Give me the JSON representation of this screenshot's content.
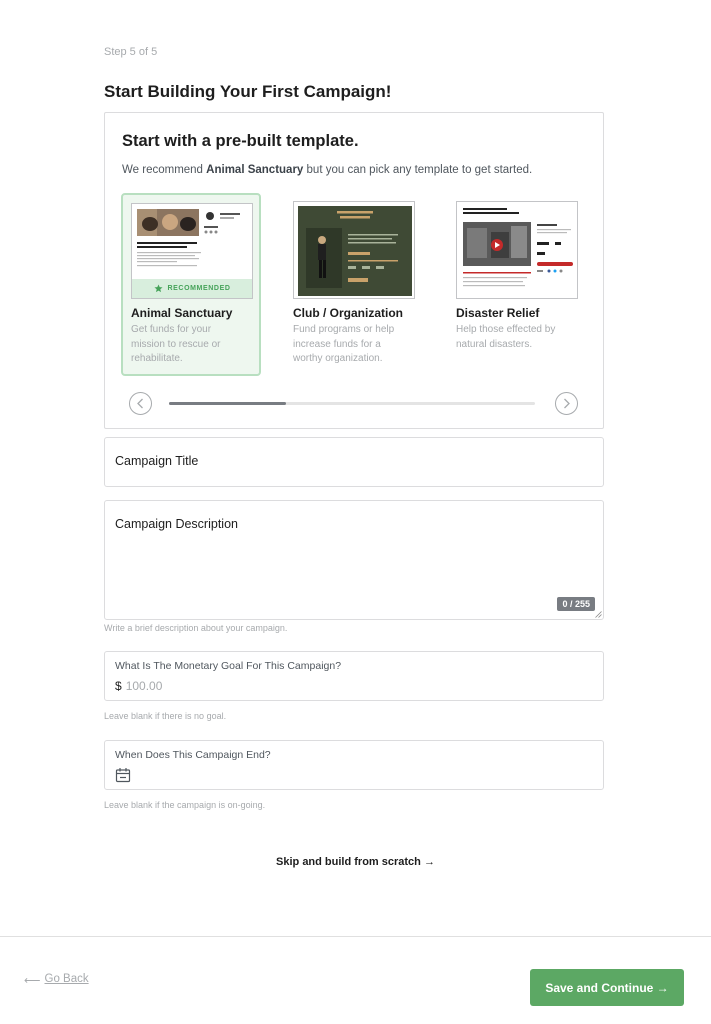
{
  "step": "Step 5 of 5",
  "page_title": "Start Building Your First Campaign!",
  "templates_section": {
    "heading": "Start with a pre-built template.",
    "sub_prefix": "We recommend",
    "sub_highlight": "Animal Sanctuary",
    "sub_suffix": "but you can pick any template to get started.",
    "recommended_badge": "RECOMMENDED",
    "items": [
      {
        "name": "Animal Sanctuary",
        "description": "Get funds for your mission to rescue or rehabilitate.",
        "selected": true,
        "thumbnail_text": "Be our Hero & support our mission to rescue, rehabilitate and re-home"
      },
      {
        "name": "Club / Organization",
        "description": "Fund programs or help increase funds for a worthy organization.",
        "selected": false,
        "thumbnail_text": "World's Iconic Golf Destination"
      },
      {
        "name": "Disaster Relief",
        "description": "Help those effected by natural disasters.",
        "selected": false,
        "thumbnail_text": "Help those affected by the earthquake in Turkey and Syria"
      }
    ],
    "prev_icon": "chevron-left-icon",
    "next_icon": "chevron-right-icon",
    "scroll_progress": 0.32
  },
  "form": {
    "title_label": "Campaign Title",
    "description_label": "Campaign Description",
    "description_counter": "0 / 255",
    "description_hint": "Write a brief description about your campaign.",
    "goal_label": "What Is The Monetary Goal For This Campaign?",
    "goal_currency": "$",
    "goal_placeholder": "100.00",
    "goal_hint": "Leave blank if there is no goal.",
    "end_label": "When Does This Campaign End?",
    "end_icon": "calendar-icon",
    "end_hint": "Leave blank if the campaign is on-going."
  },
  "skip_link": "Skip and build from scratch →",
  "footer": {
    "back_arrow": "⟵",
    "back_label": "Go Back",
    "save_label": "Save and Continue →"
  },
  "colors": {
    "accent_green": "#5ca864",
    "selected_bg": "#eef7ef",
    "selected_border": "#b8dfc0",
    "golf_bg": "#3f4a35"
  }
}
